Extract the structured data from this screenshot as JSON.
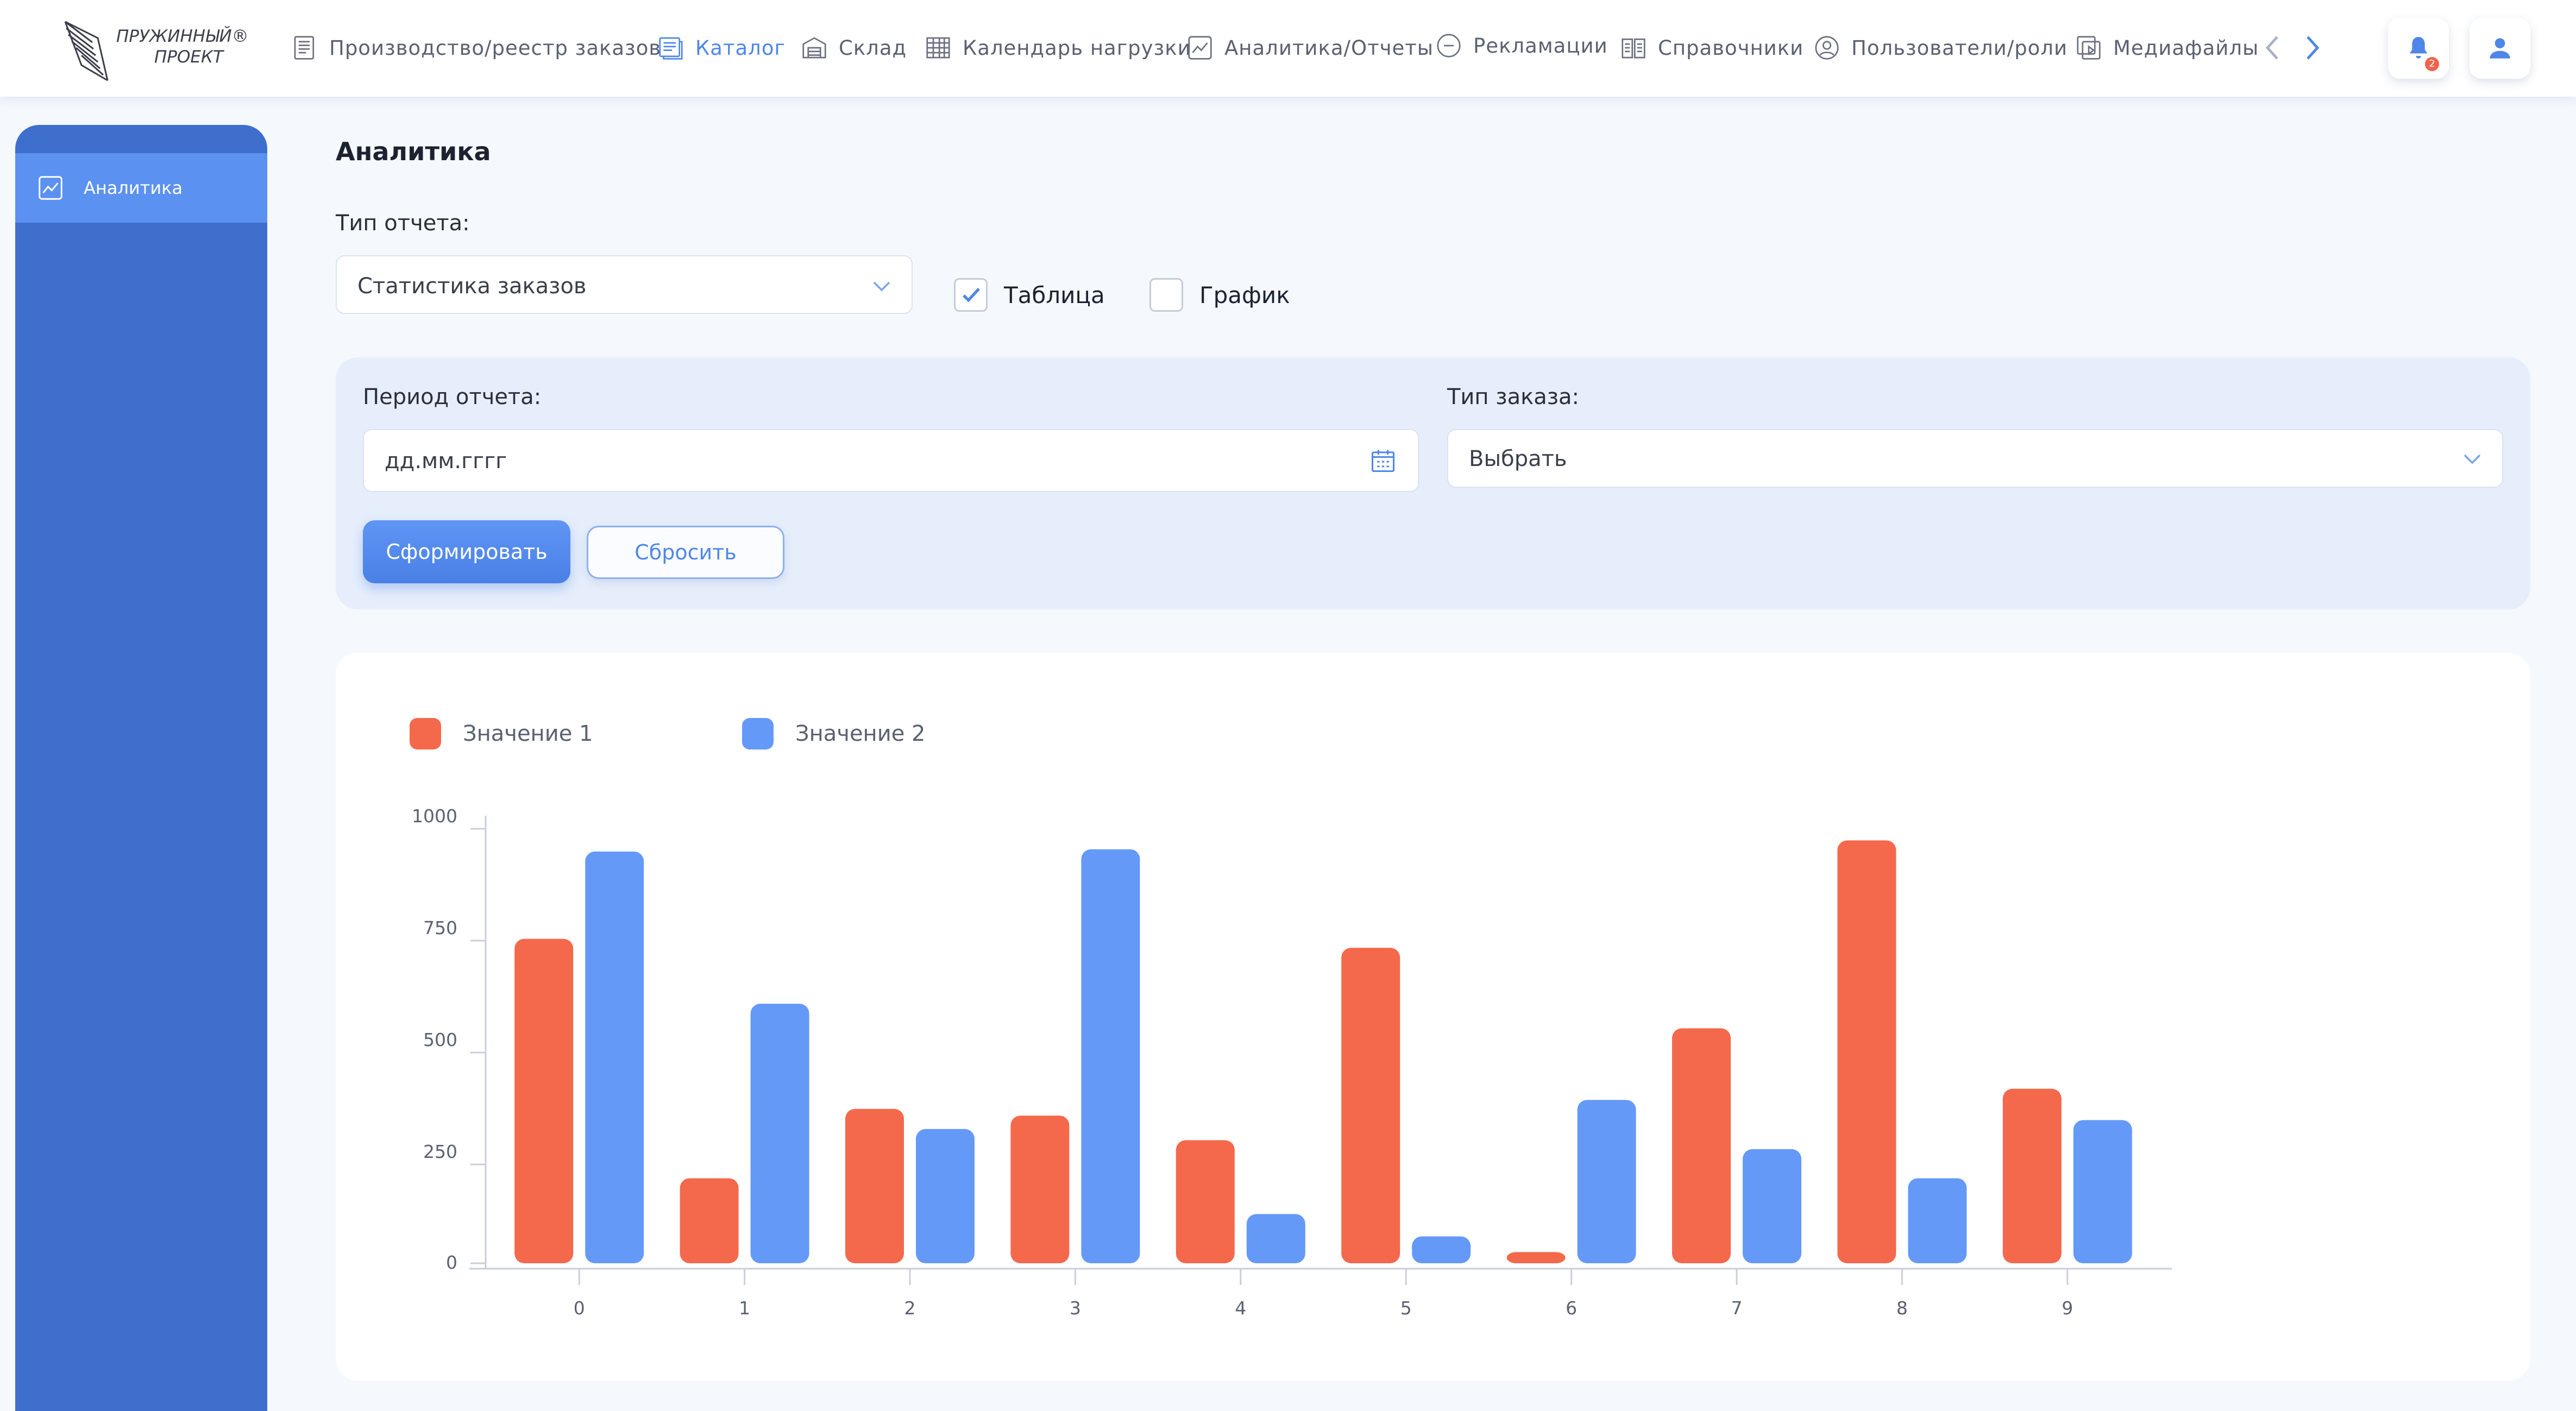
{
  "nav": {
    "logo_text_line1": "ПРУЖИННЫЙ®",
    "logo_text_line2": "ПРОЕКТ",
    "items": [
      {
        "label": "Производство/реестр заказов",
        "icon": "document-list-icon"
      },
      {
        "label": "Каталог",
        "icon": "catalog-icon",
        "active": true
      },
      {
        "label": "Склад",
        "icon": "warehouse-icon"
      },
      {
        "label": "Календарь нагрузки",
        "icon": "calendar-grid-icon"
      },
      {
        "label": "Аналитика/Отчеты",
        "icon": "analytics-icon"
      },
      {
        "label": "Рекламации",
        "icon": "complaint-icon"
      },
      {
        "label": "Справочники",
        "icon": "book-icon"
      },
      {
        "label": "Пользователи/роли",
        "icon": "user-circle-icon"
      },
      {
        "label": "Медиафайлы",
        "icon": "media-icon"
      }
    ],
    "notification_count": "2"
  },
  "sidebar": {
    "items": [
      {
        "label": "Аналитика",
        "icon": "analytics-icon"
      }
    ]
  },
  "main": {
    "title": "Аналитика",
    "report_type_label": "Тип отчета:",
    "report_type_value": "Статистика заказов",
    "view_table_label": "Таблица",
    "view_table_checked": true,
    "view_chart_label": "График",
    "view_chart_checked": false
  },
  "filters": {
    "period_label": "Период отчета:",
    "period_placeholder": "дд.мм.гггг",
    "order_type_label": "Тип заказа:",
    "order_type_value": "Выбрать",
    "generate_label": "Сформировать",
    "reset_label": "Сбросить"
  },
  "colors": {
    "accent": "#4f86e8",
    "series1": "#f4694b",
    "series2": "#6599f8"
  },
  "chart_data": {
    "type": "bar",
    "categories": [
      "0",
      "1",
      "2",
      "3",
      "4",
      "5",
      "6",
      "7",
      "8",
      "9"
    ],
    "series": [
      {
        "name": "Значение 1",
        "values": [
          725,
          190,
          345,
          330,
          275,
          705,
          25,
          525,
          945,
          390
        ]
      },
      {
        "name": "Значение 2",
        "values": [
          920,
          580,
          300,
          925,
          110,
          60,
          365,
          255,
          190,
          320
        ]
      }
    ],
    "yticks": [
      0,
      250,
      500,
      750,
      1000
    ],
    "ylim": [
      0,
      1000
    ],
    "legend": "top-left",
    "grid": false
  }
}
